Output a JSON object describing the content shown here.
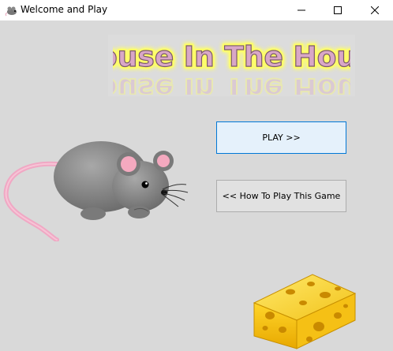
{
  "window": {
    "title": "Welcome and Play",
    "controls": [
      "minimize",
      "maximize",
      "close"
    ]
  },
  "banner": {
    "text": "Mouse In The House",
    "text_color": "#d9a7c7",
    "outline_color": "#7a5a6a",
    "glow_color": "#ffff66"
  },
  "buttons": {
    "play_label": "PLAY >>",
    "how_to_label": "<< How To Play This Game"
  },
  "icons": {
    "app": "mouse-icon",
    "minimize": "minimize-icon",
    "maximize": "maximize-icon",
    "close": "close-icon"
  },
  "images": {
    "mouse": "mouse-illustration",
    "cheese": "cheese-illustration"
  }
}
